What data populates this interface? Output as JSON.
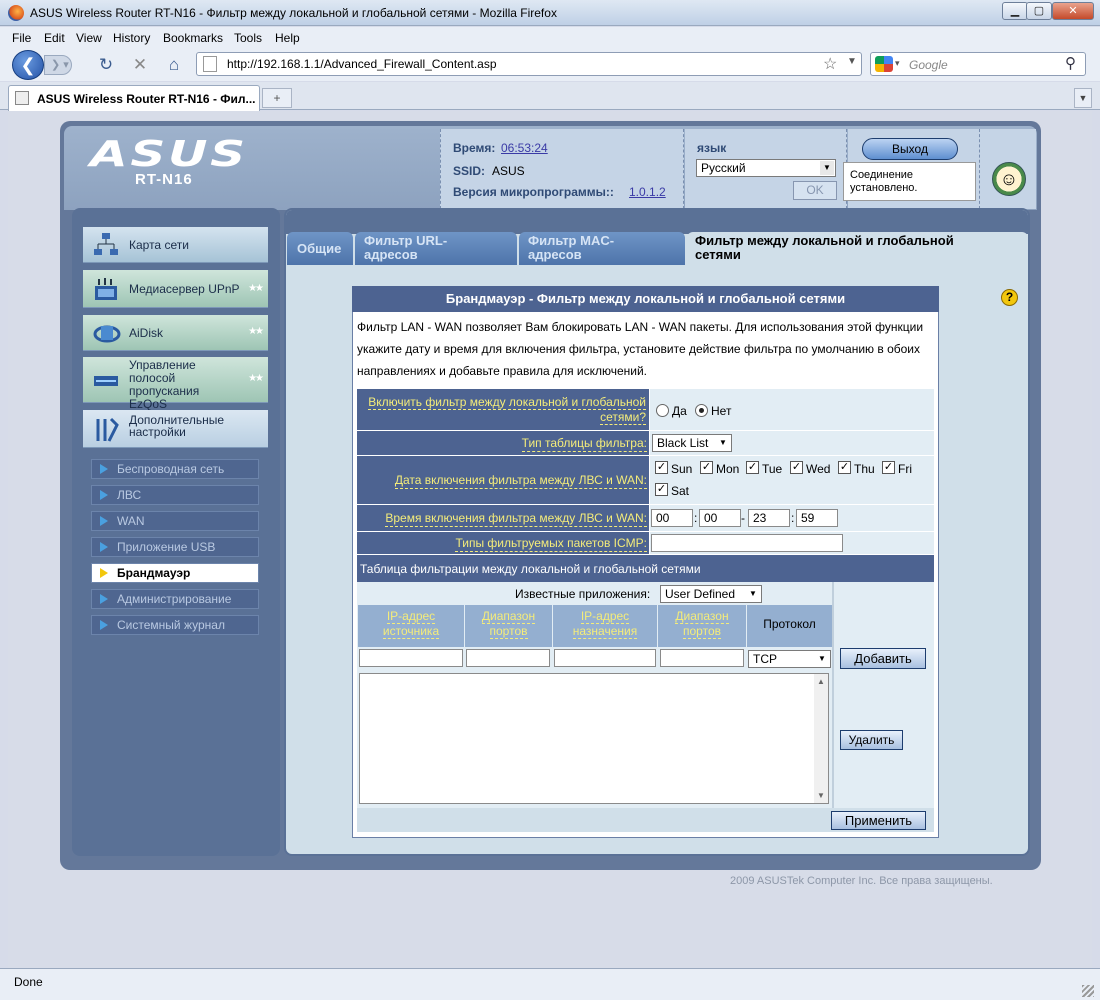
{
  "window": {
    "title": "ASUS Wireless Router RT-N16 - Фильтр между локальной и глобальной сетями - Mozilla Firefox"
  },
  "menubar": [
    "File",
    "Edit",
    "View",
    "History",
    "Bookmarks",
    "Tools",
    "Help"
  ],
  "nav": {
    "url": "http://192.168.1.1/Advanced_Firewall_Content.asp",
    "search_placeholder": "Google"
  },
  "tab": {
    "label": "ASUS Wireless Router RT-N16 - Фил..."
  },
  "router": {
    "logo": "ASUS",
    "model": "RT-N16",
    "time_label": "Время:",
    "time_value": "06:53:24",
    "ssid_label": "SSID:",
    "ssid_value": "ASUS",
    "fw_label": "Версия микропрограммы::",
    "fw_value": "1.0.1.2",
    "lang_label": "язык",
    "lang_value": "Русский",
    "ok_label": "OK",
    "logout_label": "Выход",
    "status_bubble": "Соединение установлено."
  },
  "sidebar": {
    "main_items": [
      {
        "label": "Карта сети"
      },
      {
        "label": "Медиасервер UPnP"
      },
      {
        "label": "AiDisk"
      },
      {
        "label": "Управление полосой пропускания EzQoS"
      },
      {
        "label": "Дополнительные настройки"
      }
    ],
    "sub_items": [
      {
        "label": "Беспроводная сеть"
      },
      {
        "label": "ЛВС"
      },
      {
        "label": "WAN"
      },
      {
        "label": "Приложение USB"
      },
      {
        "label": "Брандмауэр"
      },
      {
        "label": "Администрирование"
      },
      {
        "label": "Системный журнал"
      }
    ]
  },
  "tabs": [
    {
      "label": "Общие"
    },
    {
      "label": "Фильтр URL-адресов"
    },
    {
      "label": "Фильтр MAC-адресов"
    },
    {
      "label": "Фильтр между локальной и глобальной сетями"
    }
  ],
  "form": {
    "title": "Брандмауэр - Фильтр между локальной и глобальной сетями",
    "description": "Фильтр LAN - WAN позволяет Вам блокировать LAN - WAN пакеты. Для использования этой функции укажите дату и время для включения фильтра, установите действие фильтра по умолчанию в обоих направлениях и добавьте правила для исключений.",
    "enable_label": "Включить фильтр между локальной и глобальной сетями?",
    "yes": "Да",
    "no": "Нет",
    "enabled": false,
    "table_type_label": "Тип таблицы фильтра:",
    "table_type_value": "Black List",
    "date_label": "Дата включения фильтра между ЛВС и WAN:",
    "days": [
      {
        "label": "Sun",
        "checked": true
      },
      {
        "label": "Mon",
        "checked": true
      },
      {
        "label": "Tue",
        "checked": true
      },
      {
        "label": "Wed",
        "checked": true
      },
      {
        "label": "Thu",
        "checked": true
      },
      {
        "label": "Fri",
        "checked": true
      },
      {
        "label": "Sat",
        "checked": true
      }
    ],
    "time_label": "Время включения фильтра между ЛВС и WAN:",
    "time_values": [
      "00",
      "00",
      "23",
      "59"
    ],
    "icmp_label": "Типы фильтруемых пакетов ICMP:",
    "icmp_value": "",
    "table_title": "Таблица фильтрации между локальной и глобальной сетями",
    "known_apps_label": "Известные приложения:",
    "known_apps_value": "User Defined",
    "columns": [
      "IP-адрес источника",
      "Диапазон портов",
      "IP-адрес назначения",
      "Диапазон портов",
      "Протокол"
    ],
    "protocol_value": "TCP",
    "add_label": "Добавить",
    "delete_label": "Удалить",
    "apply_label": "Применить"
  },
  "footer": "2009 ASUSTek Computer Inc. Все права защищены.",
  "status": "Done"
}
